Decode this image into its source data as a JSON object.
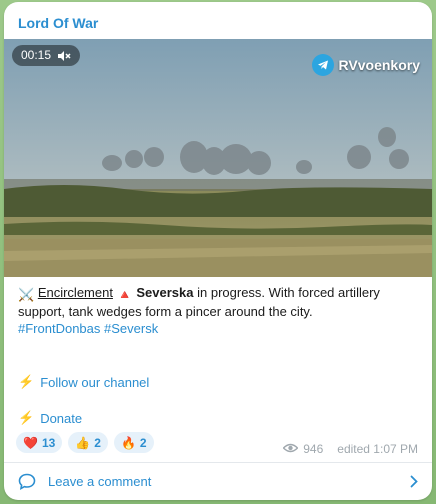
{
  "channel": {
    "name": "Lord Of War"
  },
  "media": {
    "duration": "00:15",
    "watermark": "RVvoenkory"
  },
  "post": {
    "emoji_swords": "⚔️",
    "link_text": "Encirclement",
    "emoji_triangle": "🔺",
    "place": "Severska",
    "line1_rest": " in progress. With forced artillery",
    "line2": "support, tank wedges form a pincer around the city.",
    "hashtag1": "#FrontDonbas",
    "hashtag2": "#Seversk"
  },
  "actions": {
    "follow_emoji": "⚡",
    "follow_label": "Follow our channel",
    "donate_emoji": "⚡",
    "donate_label": "Donate"
  },
  "reactions": [
    {
      "emoji": "❤️",
      "count": "13"
    },
    {
      "emoji": "👍",
      "count": "2"
    },
    {
      "emoji": "🔥",
      "count": "2"
    }
  ],
  "meta": {
    "views": "946",
    "edited": "edited 1:07 PM"
  },
  "comment": {
    "label": "Leave a comment"
  },
  "colors": {
    "accent": "#2b8ed0",
    "reaction_bg": "#e6f1fa",
    "muted": "#a0a8ae"
  }
}
